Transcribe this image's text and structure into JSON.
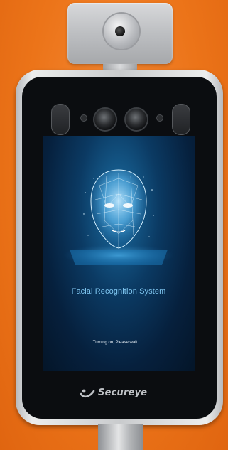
{
  "screen": {
    "title": "Facial Recognition System",
    "status": "Turning on, Please wait......"
  },
  "brand": {
    "name": "Secureye",
    "logo_icon": "swoosh-logo-icon"
  },
  "colors": {
    "background": "#f07a22",
    "screen_glow": "#1b6ea3",
    "title_text": "#7fc6f0"
  }
}
